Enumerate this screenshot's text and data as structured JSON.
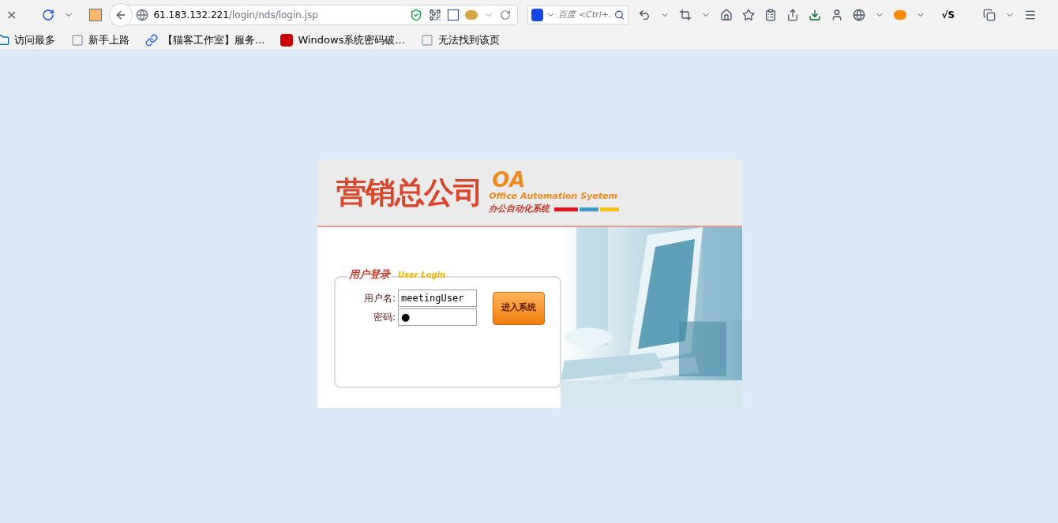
{
  "browser": {
    "close_glyph": "×",
    "url_host": "61.183.132.221",
    "url_path": "/login/nds/login.jsp",
    "search_placeholder": "百度 <Ctrl+.",
    "script_glyph": "√S"
  },
  "bookmarks": [
    {
      "label": "访问最多",
      "kind": "folder"
    },
    {
      "label": "新手上路",
      "kind": "page"
    },
    {
      "label": "【猫客工作室】服务...",
      "kind": "link"
    },
    {
      "label": "Windows系统密码破...",
      "kind": "brand"
    },
    {
      "label": "无法找到该页",
      "kind": "page"
    }
  ],
  "login": {
    "brand": "营销总公司",
    "oa": "OA",
    "subtitle": "Office Automation Syetem",
    "subtitle_cn": "办公自动化系统",
    "title": "用户登录",
    "title_en": "User Login",
    "fields": [
      {
        "label": "用户名:",
        "value": "meetingUser",
        "kind": "text"
      },
      {
        "label": "密码:",
        "value": "●",
        "kind": "password"
      }
    ],
    "button": "进入系统"
  }
}
